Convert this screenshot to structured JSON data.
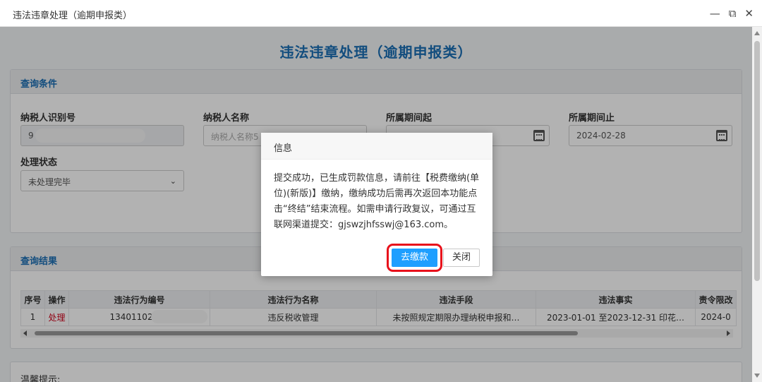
{
  "window": {
    "title": "违法违章处理（逾期申报类）",
    "controls": {
      "minimize": "—",
      "maximize": "⧉",
      "close": "✕"
    }
  },
  "page": {
    "title": "违法违章处理（逾期申报类）"
  },
  "query_panel": {
    "header": "查询条件",
    "fields": {
      "taxpayer_id": {
        "label": "纳税人识别号",
        "value": "9"
      },
      "taxpayer_name": {
        "label": "纳税人名称",
        "placeholder": "纳税人名称5"
      },
      "period_start": {
        "label": "所属期间起",
        "value": ""
      },
      "period_end": {
        "label": "所属期间止",
        "value": "2024-02-28"
      },
      "status": {
        "label": "处理状态",
        "value": "未处理完毕"
      }
    }
  },
  "result_panel": {
    "header": "查询结果",
    "columns": [
      "序号",
      "操作",
      "违法行为编号",
      "违法行为名称",
      "违法手段",
      "违法事实",
      "责令限改"
    ],
    "rows": [
      {
        "index": "1",
        "action": "处理",
        "code": "13401102024",
        "name": "违反税收管理",
        "method": "未按照规定期限办理纳税申报和…",
        "fact": "2023-01-01 至2023-12-31 印花…",
        "deadline": "2024-0"
      }
    ]
  },
  "notice_panel": {
    "header": "温馨提示:"
  },
  "dialog": {
    "title": "信息",
    "message": "提交成功，已生成罚款信息，请前往【税费缴纳(单位)(新版)】缴纳，缴纳成功后需再次返回本功能点击“终结”结束流程。如需申请行政复议，可通过互联网渠道提交：gjswzjhfsswj@163.com。",
    "confirm_label": "去缴款",
    "close_label": "关闭",
    "highlight_color": "#e8101b"
  },
  "colors": {
    "accent": "#1b6fb5",
    "primary_button": "#1e9fff",
    "action_link": "#d0021b"
  }
}
